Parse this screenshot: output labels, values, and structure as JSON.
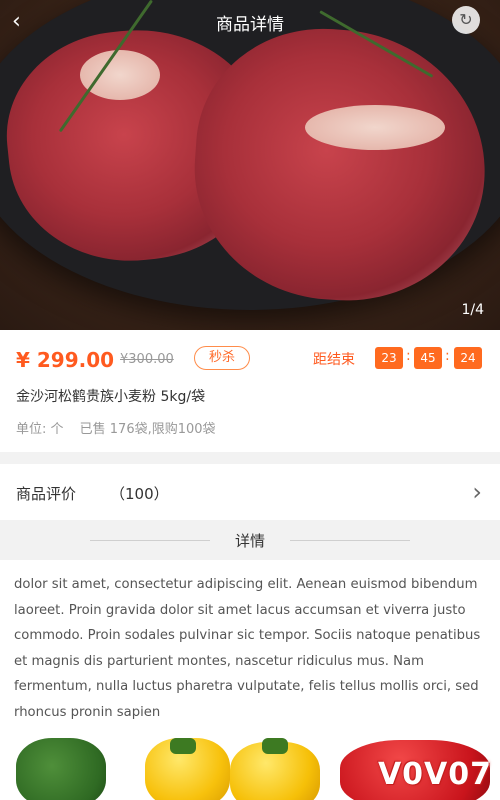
{
  "header": {
    "title": "商品详情",
    "pager": "1/4"
  },
  "product": {
    "price": "¥ 299.00",
    "old_price": "¥300.00",
    "flash_tag": "秒杀",
    "countdown_label": "距结束",
    "countdown": {
      "h": "23",
      "m": "45",
      "s": "24"
    },
    "name": "金沙河松鹤贵族小麦粉 5kg/袋",
    "meta": {
      "unit": "单位:  个",
      "sold": "已售  176袋,限购100袋"
    }
  },
  "reviews": {
    "label": "商品评价",
    "count": "（100）"
  },
  "detail": {
    "title": "详情",
    "text": " dolor sit amet, consectetur adipiscing elit. Aenean euismod bibendum laoreet. Proin gravida dolor sit amet lacus accumsan et viverra justo commodo. Proin sodales pulvinar sic tempor. Sociis natoque penatibus et magnis dis parturient montes, nascetur ridiculus mus. Nam fermentum, nulla luctus pharetra vulputate, felis tellus mollis orci, sed rhoncus pronin sapien"
  },
  "watermark": "V0V07",
  "colors": {
    "accent": "#ff5a1f",
    "band": "#f2f2f2"
  }
}
